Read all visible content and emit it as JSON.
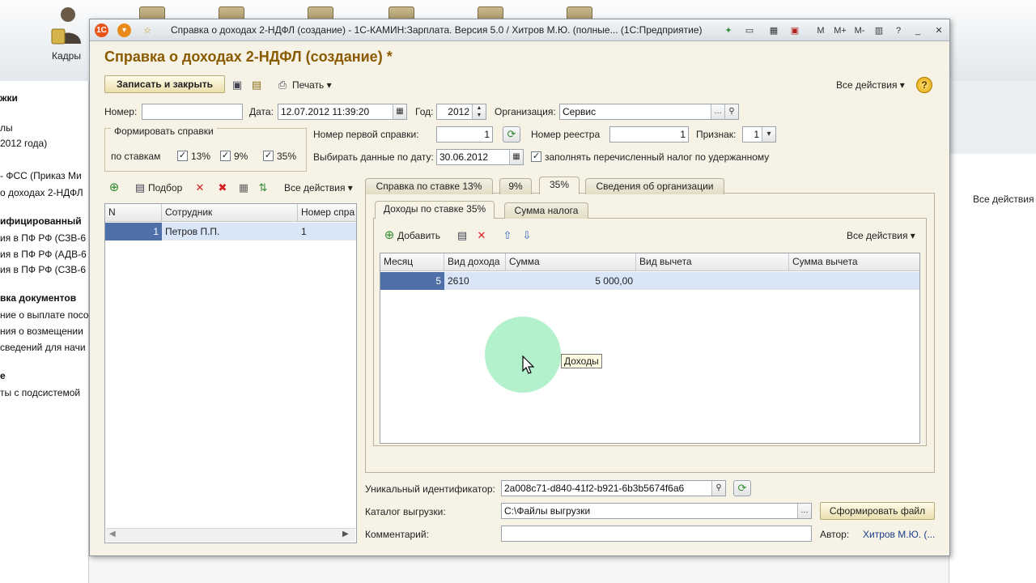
{
  "background": {
    "kadry_label": "Кадры",
    "left_lines": [
      {
        "text": "жки",
        "bold": true
      },
      {
        "text": "лы",
        "bold": false
      },
      {
        "text": "2012 года)",
        "bold": false
      },
      {
        "text": "- ФСС (Приказ Ми",
        "bold": false
      },
      {
        "text": "о доходах 2-НДФЛ",
        "bold": false
      },
      {
        "text": "ифицированный",
        "bold": true
      },
      {
        "text": "ия в ПФ РФ (СЗВ-6",
        "bold": false
      },
      {
        "text": "ия в ПФ РФ (АДВ-6",
        "bold": false
      },
      {
        "text": "ия в ПФ РФ (СЗВ-6",
        "bold": false
      },
      {
        "text": "вка документов",
        "bold": true
      },
      {
        "text": "ние о выплате посо",
        "bold": false
      },
      {
        "text": "ния о возмещении",
        "bold": false
      },
      {
        "text": "сведений для начи",
        "bold": false
      },
      {
        "text": "е",
        "bold": true
      },
      {
        "text": "ты с подсистемой",
        "bold": false
      }
    ],
    "right_actions": "Все действия"
  },
  "window": {
    "title": "Справка о доходах 2-НДФЛ (создание) - 1С-КАМИН:Зарплата. Версия 5.0 / Хитров М.Ю. (полные... (1С:Предприятие)",
    "toolbar_right_labels": [
      "M",
      "M+",
      "M-"
    ]
  },
  "form": {
    "title": "Справка о доходах 2-НДФЛ (создание) *",
    "save_close_label": "Записать и закрыть",
    "print_label": "Печать",
    "all_actions_label": "Все действия",
    "help_label": "?",
    "number_label": "Номер:",
    "number_value": "",
    "date_label": "Дата:",
    "date_value": "12.07.2012 11:39:20",
    "year_label": "Год:",
    "year_value": "2012",
    "org_label": "Организация:",
    "org_value": "Сервис",
    "group_title": "Формировать справки",
    "by_rates_label": "по ставкам",
    "rate13_label": "13%",
    "rate9_label": "9%",
    "rate35_label": "35%",
    "first_number_label": "Номер первой справки:",
    "first_number_value": "1",
    "registry_label": "Номер реестра",
    "registry_value": "1",
    "sign_label": "Признак:",
    "sign_value": "1",
    "select_date_label": "Выбирать данные по дату:",
    "select_date_value": "30.06.2012",
    "fill_tax_label": "заполнять перечисленный налог по удержанному"
  },
  "left_panel": {
    "pick_label": "Подбор",
    "all_actions_label": "Все действия",
    "columns": [
      "N",
      "Сотрудник",
      "Номер спра"
    ],
    "rows": [
      {
        "n": "1",
        "employee": "Петров П.П.",
        "cert": "1"
      }
    ]
  },
  "tabs": {
    "labels": [
      "Справка по ставке 13%",
      "9%",
      "35%",
      "Сведения об организации"
    ],
    "active": 2
  },
  "subtabs": {
    "labels": [
      "Доходы по ставке 35%",
      "Сумма налога"
    ],
    "active": 0
  },
  "income_table": {
    "add_label": "Добавить",
    "all_actions_label": "Все действия",
    "columns": [
      "Месяц",
      "Вид дохода",
      "Сумма",
      "Вид вычета",
      "Сумма вычета"
    ],
    "rows": [
      {
        "month": "5",
        "income_type": "2610",
        "sum": "5 000,00",
        "deduction_type": "",
        "deduction_sum": ""
      }
    ]
  },
  "tooltip": "Доходы",
  "bottom": {
    "uid_label": "Уникальный идентификатор:",
    "uid_value": "2a008c71-d840-41f2-b921-6b3b5674f6a6",
    "export_dir_label": "Каталог выгрузки:",
    "export_dir_value": "C:\\Файлы выгрузки",
    "form_file_label": "Сформировать файл",
    "comment_label": "Комментарий:",
    "comment_value": "",
    "author_label": "Автор:",
    "author_value": "Хитров М.Ю. (..."
  },
  "colors": {
    "form_title": "#8a5a00",
    "window_bg": "#f6f3e6",
    "selection": "#d9e6f7",
    "active_cell": "#4f6fa8",
    "highlight": "#94ecb8"
  }
}
